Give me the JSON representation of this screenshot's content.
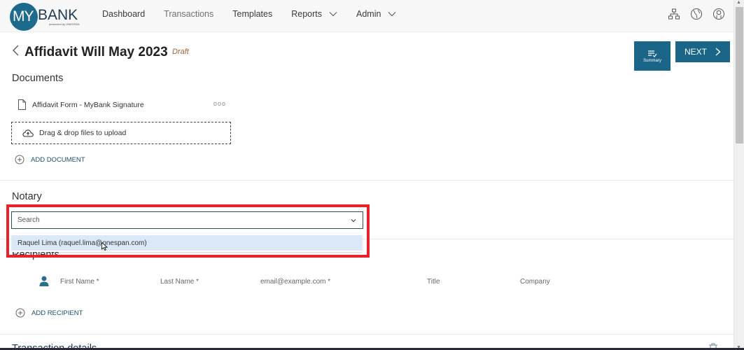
{
  "app": {
    "logo": {
      "my": "MY",
      "bank": "BANK",
      "subtitle": "presented by ONESPAN"
    },
    "nav": [
      {
        "label": "Dashboard",
        "has_dropdown": false
      },
      {
        "label": "Transactions",
        "has_dropdown": false,
        "muted": true
      },
      {
        "label": "Templates",
        "has_dropdown": false
      },
      {
        "label": "Reports",
        "has_dropdown": true
      },
      {
        "label": "Admin",
        "has_dropdown": true
      }
    ],
    "top_icons": [
      "org-chart-icon",
      "globe-icon",
      "user-profile-icon"
    ]
  },
  "header": {
    "title": "Affidavit Will May 2023",
    "status": "Draft",
    "summary_label": "Summary",
    "next_label": "NEXT"
  },
  "documents": {
    "title": "Documents",
    "items": [
      {
        "name": "Affidavit Form - MyBank Signature",
        "menu": "ooo"
      }
    ],
    "dropzone_label": "Drag & drop files to upload",
    "add_label": "ADD DOCUMENT"
  },
  "notary": {
    "title": "Notary",
    "search_placeholder": "Search",
    "options": [
      "Raquel Lima (raquel.lima@onespan.com)"
    ]
  },
  "recipients": {
    "title": "Recipients",
    "fields": {
      "first_name": "First Name *",
      "last_name": "Last Name *",
      "email": "email@example.com *",
      "title": "Title",
      "company": "Company"
    },
    "add_label": "ADD RECIPIENT"
  },
  "transaction_details": {
    "title": "Transaction details"
  },
  "colors": {
    "brand": "#1b6688",
    "status_draft": "#a0623a",
    "highlight": "#e8212b",
    "option_hover": "#dbe8f7"
  }
}
